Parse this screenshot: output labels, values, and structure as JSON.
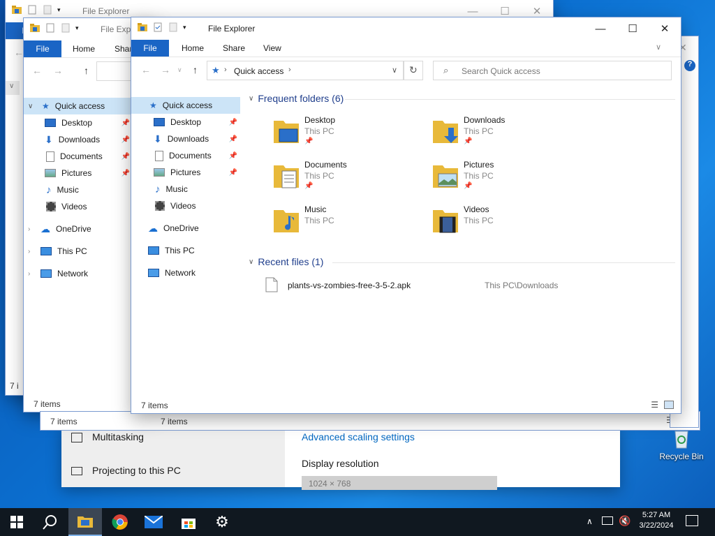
{
  "app_title": "File Explorer",
  "ribbon": {
    "file": "File",
    "home": "Home",
    "share": "Share",
    "view": "View"
  },
  "address": {
    "location": "Quick access"
  },
  "search": {
    "placeholder": "Search Quick access"
  },
  "sidebar": {
    "quick_access": "Quick access",
    "items": [
      {
        "label": "Desktop",
        "icon": "desktop-icon"
      },
      {
        "label": "Downloads",
        "icon": "downloads-icon"
      },
      {
        "label": "Documents",
        "icon": "documents-icon"
      },
      {
        "label": "Pictures",
        "icon": "pictures-icon"
      },
      {
        "label": "Music",
        "icon": "music-icon"
      },
      {
        "label": "Videos",
        "icon": "videos-icon"
      }
    ],
    "onedrive": "OneDrive",
    "this_pc": "This PC",
    "network": "Network"
  },
  "frequent": {
    "header": "Frequent folders (6)",
    "folders": [
      {
        "name": "Desktop",
        "location": "This PC",
        "pinned": true
      },
      {
        "name": "Downloads",
        "location": "This PC",
        "pinned": true
      },
      {
        "name": "Documents",
        "location": "This PC",
        "pinned": true
      },
      {
        "name": "Pictures",
        "location": "This PC",
        "pinned": true
      },
      {
        "name": "Music",
        "location": "This PC",
        "pinned": false
      },
      {
        "name": "Videos",
        "location": "This PC",
        "pinned": false
      }
    ]
  },
  "recent": {
    "header": "Recent files (1)",
    "files": [
      {
        "name": "plants-vs-zombies-free-3-5-2.apk",
        "path": "This PC\\Downloads"
      }
    ]
  },
  "status": {
    "items": "7 items",
    "back_items": "7 items",
    "far_items": "7 i"
  },
  "settings_window": {
    "multitasking": "Multitasking",
    "projecting": "Projecting to this PC",
    "advanced_scaling": "Advanced scaling settings",
    "display_resolution": "Display resolution",
    "resolution_value": "1024 × 768"
  },
  "desktop": {
    "recycle_bin": "Recycle Bin"
  },
  "taskbar": {
    "time": "5:27 AM",
    "date": "3/22/2024"
  },
  "colors": {
    "accent": "#1a65c5",
    "taskbar": "#101820",
    "selection": "#cce4f7"
  }
}
